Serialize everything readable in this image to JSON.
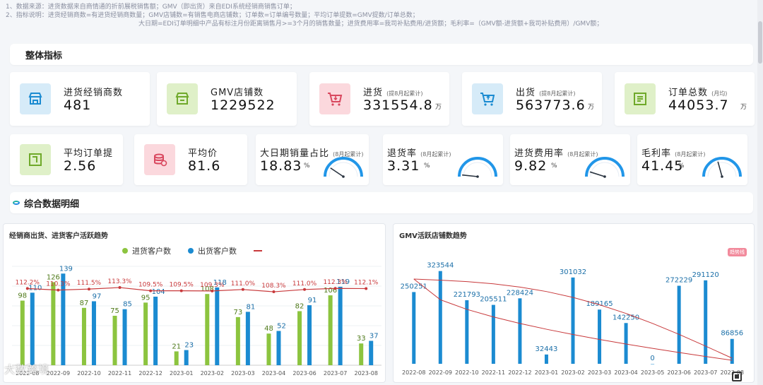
{
  "notes": [
    "1、数据来源：进货数据来自商情通的折前展税销售额；GMV（即出货）来自EDI系统经销商销售订单；",
    "2、指标说明：进货经销商数=有进货经销商数量；GMV店铺数=有销售电商店铺数；订单数=订单编号数量；平均订单提数=GMV提数/订单总数；",
    "大日期=EDI订单明细中产品有标注月份距离销售月>=3个月的销售数量；进货费用率=我司补贴费用/进货额；毛利率=（GMV额-进货额+我司补贴费用）/GMV额；"
  ],
  "sections": {
    "overall": "整体指标",
    "detail": "综合数据明细"
  },
  "kpi_row1": [
    {
      "label": "进货经销商数",
      "sub": "",
      "value": "481",
      "unit": "",
      "icon": "store-icon",
      "color": "blue"
    },
    {
      "label": "GMV店铺数",
      "sub": "",
      "value": "1229522",
      "unit": "",
      "icon": "shop-icon",
      "color": "green"
    },
    {
      "label": "进货",
      "sub": "(提8月起累计)",
      "value": "331554.8",
      "unit": "万",
      "icon": "cart-in-icon",
      "color": "pink"
    },
    {
      "label": "出货",
      "sub": "(提8月起累计)",
      "value": "563773.6",
      "unit": "万",
      "icon": "cart-out-icon",
      "color": "blue"
    },
    {
      "label": "订单总数",
      "sub": "(月均)",
      "value": "44053.7",
      "unit": "万",
      "icon": "order-icon",
      "color": "green"
    }
  ],
  "kpi_row2": [
    {
      "label": "平均订单提",
      "value": "2.56",
      "icon": "box-icon",
      "color": "green"
    },
    {
      "label": "平均价",
      "value": "81.6",
      "icon": "coin-icon",
      "color": "pink"
    }
  ],
  "gauges": [
    {
      "label": "大日期销量占比",
      "sub": "(8月起累计)",
      "value": "18.83",
      "unit": "%",
      "pct": 0.1883
    },
    {
      "label": "退货率",
      "sub": "(8月起累计)",
      "value": "3.31",
      "unit": "%",
      "pct": 0.0331
    },
    {
      "label": "进货费用率",
      "sub": "(8月起累计)",
      "value": "9.82",
      "unit": "%",
      "pct": 0.0982
    },
    {
      "label": "毛利率",
      "sub": "(8月起累计)",
      "value": "41.45",
      "unit": "%",
      "pct": 0.4145
    }
  ],
  "colors": {
    "blue": "#1b8bd1",
    "green": "#8cc43f",
    "red": "#c8393b",
    "pink": "#f28a9c"
  },
  "chart_data": [
    {
      "type": "bar",
      "title": "经销商出货、进货客户活跃趋势",
      "categories": [
        "2022-08",
        "2022-09",
        "2022-10",
        "2022-11",
        "2022-12",
        "2023-01",
        "2023-02",
        "2023-03",
        "2023-04",
        "2023-06",
        "2023-07",
        "2023-08"
      ],
      "series": [
        {
          "name": "进货客户数",
          "values": [
            98,
            126,
            87,
            75,
            95,
            21,
            108,
            73,
            48,
            82,
            106,
            33
          ]
        },
        {
          "name": "出货客户数",
          "values": [
            110,
            139,
            97,
            85,
            104,
            23,
            118,
            81,
            52,
            91,
            119,
            37
          ]
        }
      ],
      "line": {
        "name": "",
        "labels": [
          "112.2%",
          "110.3%",
          "111.5%",
          "113.3%",
          "109.5%",
          "109.5%",
          "109.3%",
          "111.0%",
          "108.3%",
          "111.0%",
          "112.3%",
          "112.1%"
        ],
        "values": [
          112.2,
          110.3,
          111.5,
          113.3,
          109.5,
          109.5,
          109.3,
          111.0,
          108.3,
          111.0,
          112.3,
          112.1
        ]
      },
      "ylim": [
        0,
        150
      ]
    },
    {
      "type": "bar",
      "title": "GMV活跃店铺数趋势",
      "badge": "趋势线",
      "categories": [
        "2022-08",
        "2022-09",
        "2022-10",
        "2022-11",
        "2022-12",
        "2023-01",
        "2023-02",
        "2023-03",
        "2023-04",
        "2023-05",
        "2023-06",
        "2023-07",
        "2023-08"
      ],
      "values": [
        250251,
        323544,
        221793,
        205511,
        228424,
        32443,
        301032,
        189165,
        142250,
        0,
        272229,
        291120,
        86856
      ],
      "ylim": [
        0,
        340000
      ]
    }
  ],
  "watermark": "大数跨境"
}
